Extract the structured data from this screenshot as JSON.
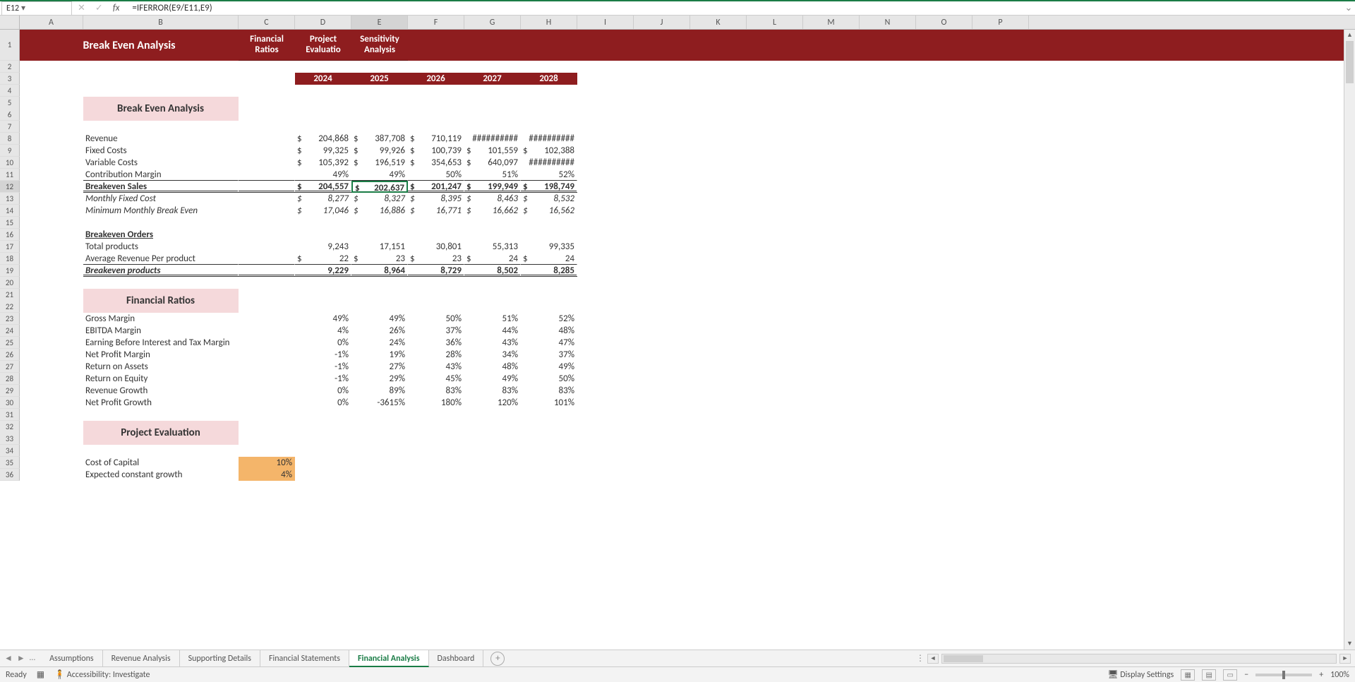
{
  "namebox": "E12",
  "formula": "=IFERROR(E9/E11,E9)",
  "columns": [
    "A",
    "B",
    "C",
    "D",
    "E",
    "F",
    "G",
    "H",
    "I",
    "J",
    "K",
    "L",
    "M",
    "N",
    "O",
    "P"
  ],
  "banner": {
    "title": "Break Even Analysis",
    "btn1a": "Financial",
    "btn1b": "Ratios",
    "btn2a": "Project",
    "btn2b": "Evaluatio",
    "btn3a": "Sensitivity",
    "btn3b": "Analysis"
  },
  "years": [
    "2024",
    "2025",
    "2026",
    "2027",
    "2028"
  ],
  "sections": {
    "bea": "Break Even Analysis",
    "fr": "Financial Ratios",
    "pe": "Project Evaluation"
  },
  "rows": {
    "revenue": {
      "label": "Revenue",
      "vals": [
        "204,868",
        "387,708",
        "710,119",
        "##########",
        "##########"
      ],
      "dollar": true
    },
    "fixed": {
      "label": "Fixed Costs",
      "vals": [
        "99,325",
        "99,926",
        "100,739",
        "101,559",
        "102,388"
      ],
      "dollar": true
    },
    "variable": {
      "label": "Variable Costs",
      "vals": [
        "105,392",
        "196,519",
        "354,653",
        "640,097",
        "##########"
      ],
      "dollar": true
    },
    "cmargin": {
      "label": "Contribution Margin",
      "vals": [
        "49%",
        "49%",
        "50%",
        "51%",
        "52%"
      ]
    },
    "besales": {
      "label": "Breakeven Sales",
      "vals": [
        "204,557",
        "202,637",
        "201,247",
        "199,949",
        "198,749"
      ],
      "dollar": true
    },
    "mfixed": {
      "label": "Monthly Fixed Cost",
      "vals": [
        "8,277",
        "8,327",
        "8,395",
        "8,463",
        "8,532"
      ],
      "dollar": true
    },
    "mmbe": {
      "label": "Minimum Monthly Break Even",
      "vals": [
        "17,046",
        "16,886",
        "16,771",
        "16,662",
        "16,562"
      ],
      "dollar": true
    },
    "beorders": {
      "label": "Breakeven Orders"
    },
    "tprod": {
      "label": "Total products",
      "vals": [
        "9,243",
        "17,151",
        "30,801",
        "55,313",
        "99,335"
      ]
    },
    "avgrev": {
      "label": "Average Revenue Per product",
      "vals": [
        "22",
        "23",
        "23",
        "24",
        "24"
      ],
      "dollar": true
    },
    "beprod": {
      "label": "Breakeven products",
      "vals": [
        "9,229",
        "8,964",
        "8,729",
        "8,502",
        "8,285"
      ]
    },
    "gm": {
      "label": "Gross Margin",
      "vals": [
        "49%",
        "49%",
        "50%",
        "51%",
        "52%"
      ]
    },
    "ebitda": {
      "label": "EBITDA Margin",
      "vals": [
        "4%",
        "26%",
        "37%",
        "44%",
        "48%"
      ]
    },
    "ebit": {
      "label": "Earning Before Interest and Tax Margin",
      "vals": [
        "0%",
        "24%",
        "36%",
        "43%",
        "47%"
      ]
    },
    "npm": {
      "label": "Net Profit Margin",
      "vals": [
        "-1%",
        "19%",
        "28%",
        "34%",
        "37%"
      ]
    },
    "roa": {
      "label": "Return on Assets",
      "vals": [
        "-1%",
        "27%",
        "43%",
        "48%",
        "49%"
      ]
    },
    "roe": {
      "label": "Return on Equity",
      "vals": [
        "-1%",
        "29%",
        "45%",
        "49%",
        "50%"
      ]
    },
    "revg": {
      "label": "Revenue Growth",
      "vals": [
        "0%",
        "89%",
        "83%",
        "83%",
        "83%"
      ]
    },
    "npg": {
      "label": "Net Profit Growth",
      "vals": [
        "0%",
        "-3615%",
        "180%",
        "120%",
        "101%"
      ]
    },
    "coc": {
      "label": "Cost of Capital",
      "val": "10%"
    },
    "ecg": {
      "label": "Expected constant growth",
      "val": "4%"
    }
  },
  "tabs": [
    "Assumptions",
    "Revenue Analysis",
    "Supporting Details",
    "Financial Statements",
    "Financial Analysis",
    "Dashboard"
  ],
  "activeTab": 4,
  "status": {
    "ready": "Ready",
    "access": "Accessibility: Investigate",
    "display": "Display Settings",
    "zoom": "100%"
  },
  "chart_data": {
    "type": "table",
    "title": "Break Even Analysis",
    "years": [
      2024,
      2025,
      2026,
      2027,
      2028
    ],
    "break_even": {
      "Revenue": [
        204868,
        387708,
        710119,
        null,
        null
      ],
      "Fixed Costs": [
        99325,
        99926,
        100739,
        101559,
        102388
      ],
      "Variable Costs": [
        105392,
        196519,
        354653,
        640097,
        null
      ],
      "Contribution Margin %": [
        49,
        49,
        50,
        51,
        52
      ],
      "Breakeven Sales": [
        204557,
        202637,
        201247,
        199949,
        198749
      ],
      "Monthly Fixed Cost": [
        8277,
        8327,
        8395,
        8463,
        8532
      ],
      "Minimum Monthly Break Even": [
        17046,
        16886,
        16771,
        16662,
        16562
      ],
      "Total products": [
        9243,
        17151,
        30801,
        55313,
        99335
      ],
      "Average Revenue Per product": [
        22,
        23,
        23,
        24,
        24
      ],
      "Breakeven products": [
        9229,
        8964,
        8729,
        8502,
        8285
      ]
    },
    "financial_ratios_pct": {
      "Gross Margin": [
        49,
        49,
        50,
        51,
        52
      ],
      "EBITDA Margin": [
        4,
        26,
        37,
        44,
        48
      ],
      "EBIT Margin": [
        0,
        24,
        36,
        43,
        47
      ],
      "Net Profit Margin": [
        -1,
        19,
        28,
        34,
        37
      ],
      "Return on Assets": [
        -1,
        27,
        43,
        48,
        49
      ],
      "Return on Equity": [
        -1,
        29,
        45,
        49,
        50
      ],
      "Revenue Growth": [
        0,
        89,
        83,
        83,
        83
      ],
      "Net Profit Growth": [
        0,
        -3615,
        180,
        120,
        101
      ]
    },
    "project_evaluation": {
      "Cost of Capital %": 10,
      "Expected constant growth %": 4
    }
  }
}
